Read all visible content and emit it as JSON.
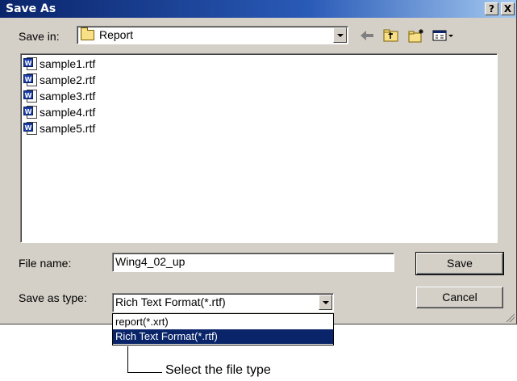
{
  "window": {
    "title": "Save As",
    "help_label": "?",
    "close_label": "X"
  },
  "save_in": {
    "label": "Save in:",
    "folder": "Report"
  },
  "toolbar": {
    "back_icon": "back-arrow-icon",
    "up_icon": "up-folder-icon",
    "new_folder_icon": "new-folder-icon",
    "view_icon": "view-menu-icon"
  },
  "files": [
    {
      "name": "sample1.rtf"
    },
    {
      "name": "sample2.rtf"
    },
    {
      "name": "sample3.rtf"
    },
    {
      "name": "sample4.rtf"
    },
    {
      "name": "sample5.rtf"
    }
  ],
  "file_name": {
    "label": "File name:",
    "value": "Wing4_02_up"
  },
  "save_as_type": {
    "label": "Save as type:",
    "value": "Rich Text Format(*.rtf)",
    "options": [
      {
        "label": "report(*.xrt)",
        "selected": false
      },
      {
        "label": "Rich Text Format(*.rtf)",
        "selected": true
      }
    ]
  },
  "buttons": {
    "save": "Save",
    "cancel": "Cancel"
  },
  "annotation": {
    "text": "Select the file type"
  },
  "colors": {
    "title_bar": "#0a246a",
    "dialog_face": "#d4d0c8",
    "selection": "#0a246a"
  }
}
